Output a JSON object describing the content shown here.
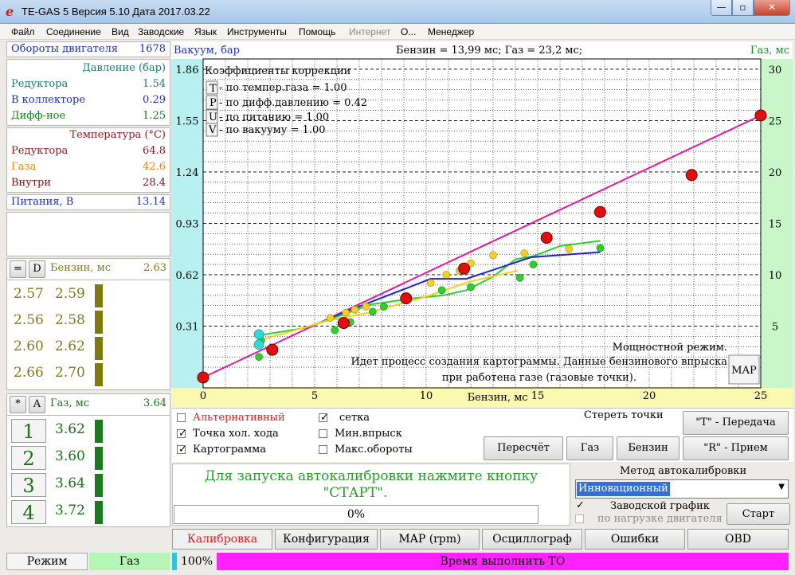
{
  "window": {
    "app_icon": "e",
    "title": "TE-GAS 5  Версия 5.10  Дата 2017.03.22",
    "minimize": "—",
    "maximize": "▫",
    "close": "✕"
  },
  "menu": [
    "Файл",
    "Соединение",
    "Вид",
    "Заводские",
    "Язык",
    "Инструменты",
    "Помощь",
    "Интернет",
    "О...",
    "Менеджер"
  ],
  "left": {
    "rpm_label": "Обороты двигателя",
    "rpm_value": "1678",
    "pressure_header": "Давление (бар)",
    "reducer_label": "Редуктора",
    "reducer_value": "1.54",
    "collector_label": "В коллекторе",
    "collector_value": "0.29",
    "diff_label": "Дифф-ное",
    "diff_value": "1.25",
    "temp_header": "Температура (°C)",
    "temp_reducer_label": "Редуктора",
    "temp_reducer_value": "64.8",
    "temp_gas_label": "Газа",
    "temp_gas_value": "42.6",
    "temp_inside_label": "Внутри",
    "temp_inside_value": "28.4",
    "supply_label": "Питания, В",
    "supply_value": "13.14",
    "petrol_eq_btn": "=",
    "petrol_d_btn": "D",
    "petrol_label": "Бензин, мс",
    "petrol_value": "2.63",
    "petrol_rows": [
      [
        "2.57",
        "2.59"
      ],
      [
        "2.56",
        "2.58"
      ],
      [
        "2.60",
        "2.62"
      ],
      [
        "2.66",
        "2.70"
      ]
    ],
    "gas_star_btn": "*",
    "gas_a_btn": "A",
    "gas_label": "Газ, мс",
    "gas_value": "3.64",
    "gas_rows": [
      [
        "1",
        "3.62"
      ],
      [
        "2",
        "3.60"
      ],
      [
        "3",
        "3.64"
      ],
      [
        "4",
        "3.72"
      ]
    ]
  },
  "chart_header": {
    "left": "Вакуум, бар",
    "center": "Бензин = 13,99 мс; Газ = 23,2 мс;",
    "right": "Газ, мс"
  },
  "corrections": {
    "title": "Коэффициенты коррекции",
    "rows": [
      {
        "key": "T",
        "text": "- по темпер.газа = 1.00"
      },
      {
        "key": "P",
        "text": "- по дифф.давлению = 0.42"
      },
      {
        "key": "U",
        "text": "- по питанию = 1.00"
      },
      {
        "key": "V",
        "text": "- по вакууму = 1.00"
      }
    ]
  },
  "chart_messages": {
    "mode": "Мощностной режим.",
    "info_line1": "Идет процесс создания картограммы. Данные бензинового впрыска",
    "info_line2": "при работена газе (газовые точки).",
    "map_button": "MAP"
  },
  "chart_data": {
    "type": "scatter",
    "xlabel": "Бензин, мс",
    "ylabel_left": "Вакуум, бар",
    "ylabel_right": "Газ, мс",
    "x_ticks": [
      0,
      5,
      10,
      15,
      20,
      25
    ],
    "left_ticks": [
      "0.31",
      "0.62",
      "0.93",
      "1.24",
      "1.55",
      "1.86"
    ],
    "right_ticks": [
      5,
      10,
      15,
      20,
      25,
      30
    ],
    "xlim": [
      0,
      25
    ],
    "ylim_right": [
      0,
      31
    ],
    "grid": true,
    "colors": {
      "line": "#e0199e",
      "red_points": "#e01010",
      "green": "#2fcf2f",
      "yellow": "#f2d21e",
      "blue": "#2222cc",
      "cyan": "#33d6d6"
    },
    "calibration_line": [
      [
        0,
        0
      ],
      [
        25,
        25.5
      ]
    ],
    "red_points": [
      [
        0,
        0
      ],
      [
        3.1,
        2.7
      ],
      [
        6.3,
        5.3
      ],
      [
        9.1,
        7.7
      ],
      [
        11.7,
        10.6
      ],
      [
        15.4,
        13.6
      ],
      [
        17.8,
        16.1
      ],
      [
        21.9,
        19.7
      ],
      [
        25,
        25.5
      ]
    ],
    "gas_curves": [
      {
        "color": "green",
        "points": [
          [
            2.5,
            4.1
          ],
          [
            4.5,
            4.8
          ],
          [
            6,
            5.9
          ],
          [
            7.5,
            7.1
          ],
          [
            9.4,
            7.7
          ],
          [
            10.8,
            8
          ],
          [
            11.8,
            8.5
          ],
          [
            13,
            9.8
          ],
          [
            14,
            11.5
          ],
          [
            14.8,
            11.8
          ],
          [
            16,
            12.8
          ],
          [
            17.8,
            13.3
          ]
        ]
      },
      {
        "color": "yellow",
        "points": [
          [
            2.5,
            3.6
          ],
          [
            5.7,
            5.6
          ],
          [
            7.4,
            6.3
          ],
          [
            9.9,
            7.8
          ],
          [
            11.9,
            9.3
          ],
          [
            14.1,
            10.4
          ]
        ]
      },
      {
        "color": "blue",
        "points": [
          [
            5.8,
            5.9
          ],
          [
            10.2,
            9.6
          ],
          [
            11.8,
            9.6
          ],
          [
            14.7,
            11.7
          ],
          [
            17.8,
            12.2
          ]
        ]
      }
    ],
    "yellow_points": [
      [
        5.7,
        5.8
      ],
      [
        6.4,
        6.3
      ],
      [
        6.8,
        6.6
      ],
      [
        7.3,
        6.9
      ],
      [
        10.2,
        9.2
      ],
      [
        10.9,
        10
      ],
      [
        11.5,
        10.4
      ],
      [
        12.0,
        11.1
      ],
      [
        13,
        11.9
      ],
      [
        14.4,
        12.1
      ],
      [
        16.4,
        12.5
      ]
    ],
    "green_points": [
      [
        2.5,
        2
      ],
      [
        2.6,
        3.6
      ],
      [
        5.9,
        4.6
      ],
      [
        6.6,
        5.4
      ],
      [
        7.6,
        6.4
      ],
      [
        8.1,
        6.9
      ],
      [
        9.1,
        7.8
      ],
      [
        10.7,
        8.5
      ],
      [
        12,
        8.8
      ],
      [
        14.2,
        9.7
      ],
      [
        14.8,
        11
      ],
      [
        17.8,
        12.6
      ]
    ],
    "cyan_points": [
      [
        2.5,
        4.2
      ],
      [
        2.5,
        3.2
      ]
    ]
  },
  "controls": {
    "alt_label": "Альтернативный",
    "idle_label": "Точка хол. хода",
    "map_label": "Картограмма",
    "grid_label": "сетка",
    "min_inj_label": "Мин.впрыск",
    "max_rpm_label": "Макс.обороты",
    "clear_points": "Стереть точки",
    "recalc": "Пересчёт",
    "gas": "Газ",
    "petrol": "Бензин",
    "t_transmit": "\"T\" - Передача",
    "r_receive": "\"R\" - Прием"
  },
  "autocal": {
    "prompt1": "Для запуска автокалибровки нажмите кнопку",
    "prompt2": "\"СТАРТ\".",
    "progress": "0%",
    "method_label": "Метод автокалибровки",
    "method_value": "Инновационный",
    "factory_label": "Заводской график",
    "load_label": "по нагрузке двигателя",
    "start": "Старт"
  },
  "tabs": [
    "Калибровка",
    "Конфигурация",
    "MAP (rpm)",
    "Осциллограф",
    "Ошибки",
    "OBD"
  ],
  "status": {
    "mode": "Режим",
    "fuel": "Газ",
    "percent": "100%",
    "service": "Время выполнить ТО"
  }
}
